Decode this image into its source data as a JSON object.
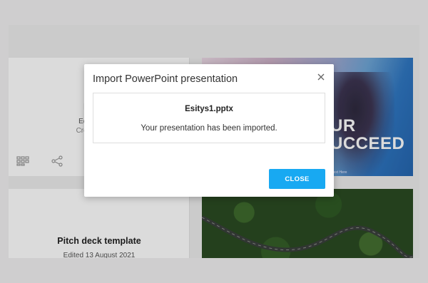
{
  "background_cards": [
    {
      "title": "Esitys1",
      "edited": "Edited Today",
      "created": "Created Today",
      "thumbnail_text": [
        "UR",
        "UCCEED"
      ],
      "thumbnail_small_text": "Text Here"
    },
    {
      "title": "Pitch deck template",
      "edited": "Edited 13 August 2021"
    }
  ],
  "dialog": {
    "title": "Import PowerPoint presentation",
    "file_name": "Esitys1.pptx",
    "message": "Your presentation has been imported.",
    "close_button": "CLOSE",
    "close_icon": "close-icon"
  },
  "colors": {
    "accent": "#18a9f2",
    "page_background": "#f1f0f1"
  }
}
